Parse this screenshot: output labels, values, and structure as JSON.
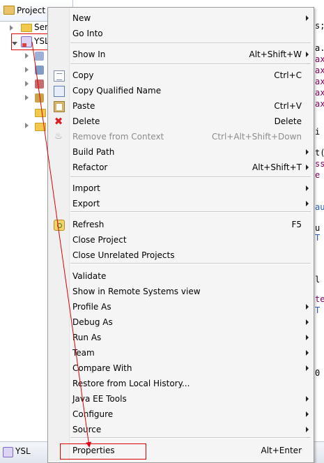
{
  "explorer": {
    "tab_label": "Project Exp",
    "tree": {
      "server_label": "Ser",
      "project_label": "YSL"
    }
  },
  "editor_fragments": [
    {
      "text": "s;",
      "cls": "plain"
    },
    {
      "text": "a.",
      "cls": "plain"
    },
    {
      "text": "ax",
      "cls": ""
    },
    {
      "text": "ax",
      "cls": ""
    },
    {
      "text": "ax",
      "cls": ""
    },
    {
      "text": "ax",
      "cls": ""
    },
    {
      "text": "ax",
      "cls": ""
    },
    {
      "text": "i",
      "cls": "plain"
    },
    {
      "text": "t(",
      "cls": "plain"
    },
    {
      "text": "ss",
      "cls": ""
    },
    {
      "text": "e",
      "cls": ""
    },
    {
      "text": "au",
      "cls": "blue"
    },
    {
      "text": "u",
      "cls": "plain"
    },
    {
      "text": "T",
      "cls": "blue"
    },
    {
      "text": "l",
      "cls": "plain"
    },
    {
      "text": "te",
      "cls": ""
    },
    {
      "text": "T",
      "cls": "blue"
    },
    {
      "text": "0",
      "cls": "plain"
    }
  ],
  "menu": {
    "items": [
      {
        "label": "New",
        "accel": "",
        "submenu": true
      },
      {
        "label": "Go Into",
        "accel": "",
        "submenu": false
      },
      {
        "sep": true
      },
      {
        "label": "Show In",
        "accel": "Alt+Shift+W",
        "submenu": true
      },
      {
        "sep": true
      },
      {
        "label": "Copy",
        "accel": "Ctrl+C",
        "icon": "copy-icon"
      },
      {
        "label": "Copy Qualified Name",
        "accel": "",
        "icon": "copy-qualified-icon"
      },
      {
        "label": "Paste",
        "accel": "Ctrl+V",
        "icon": "paste-icon"
      },
      {
        "label": "Delete",
        "accel": "Delete",
        "icon": "delete-icon"
      },
      {
        "label": "Remove from Context",
        "accel": "Ctrl+Alt+Shift+Down",
        "icon": "remove-icon",
        "disabled": true
      },
      {
        "label": "Build Path",
        "accel": "",
        "submenu": true
      },
      {
        "label": "Refactor",
        "accel": "Alt+Shift+T",
        "submenu": true
      },
      {
        "sep": true
      },
      {
        "label": "Import",
        "accel": "",
        "submenu": true
      },
      {
        "label": "Export",
        "accel": "",
        "submenu": true
      },
      {
        "sep": true
      },
      {
        "label": "Refresh",
        "accel": "F5",
        "icon": "refresh-icon"
      },
      {
        "label": "Close Project",
        "accel": ""
      },
      {
        "label": "Close Unrelated Projects",
        "accel": ""
      },
      {
        "sep": true
      },
      {
        "label": "Validate",
        "accel": ""
      },
      {
        "label": "Show in Remote Systems view",
        "accel": ""
      },
      {
        "label": "Profile As",
        "accel": "",
        "submenu": true
      },
      {
        "label": "Debug As",
        "accel": "",
        "submenu": true
      },
      {
        "label": "Run As",
        "accel": "",
        "submenu": true
      },
      {
        "label": "Team",
        "accel": "",
        "submenu": true
      },
      {
        "label": "Compare With",
        "accel": "",
        "submenu": true
      },
      {
        "label": "Restore from Local History...",
        "accel": ""
      },
      {
        "label": "Java EE Tools",
        "accel": "",
        "submenu": true
      },
      {
        "label": "Configure",
        "accel": "",
        "submenu": true
      },
      {
        "label": "Source",
        "accel": "",
        "submenu": true
      },
      {
        "sep": true
      },
      {
        "label": "Properties",
        "accel": "Alt+Enter"
      }
    ]
  },
  "bottom_bar": {
    "label": "YSL"
  },
  "colors": {
    "highlight_box": "#e00000",
    "menu_bg": "#f5f5f5"
  }
}
